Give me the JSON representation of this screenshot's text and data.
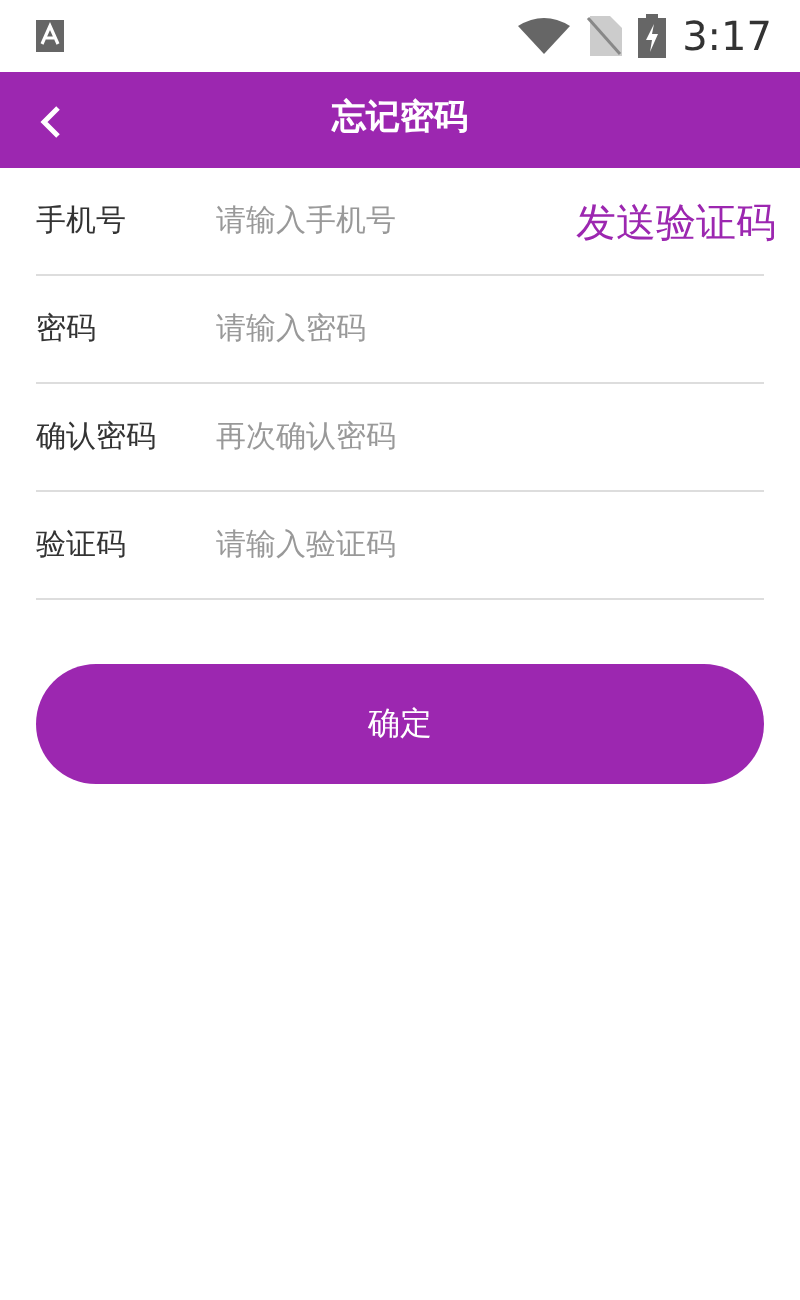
{
  "status_bar": {
    "time": "3:17"
  },
  "header": {
    "title": "忘记密码"
  },
  "fields": [
    {
      "label": "手机号",
      "placeholder": "请输入手机号",
      "action": "发送验证码"
    },
    {
      "label": "密码",
      "placeholder": "请输入密码"
    },
    {
      "label": "确认密码",
      "placeholder": "再次确认密码"
    },
    {
      "label": "验证码",
      "placeholder": "请输入验证码"
    }
  ],
  "submit": "确定"
}
